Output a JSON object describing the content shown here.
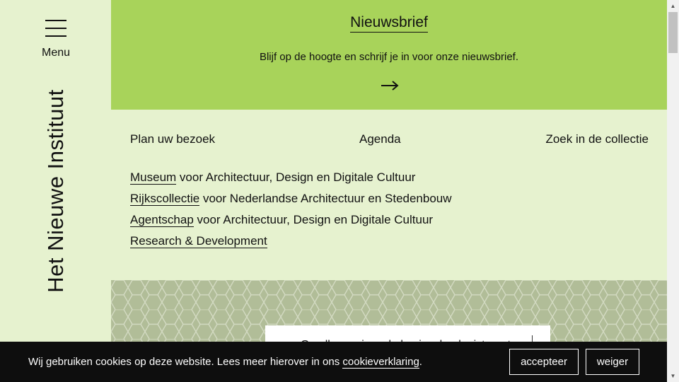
{
  "sidebar": {
    "menu_label": "Menu",
    "logo_text": "Het Nieuwe Instituut"
  },
  "newsletter": {
    "title": "Nieuwsbrief",
    "text": "Blijf op de hoogte en schrijf je in voor onze nieuwsbrief.",
    "arrow_icon": "arrow-right-icon"
  },
  "quick_links": [
    {
      "label": "Plan uw bezoek"
    },
    {
      "label": "Agenda"
    },
    {
      "label": "Zoek in de collectie"
    }
  ],
  "sections": [
    {
      "link": "Museum",
      "rest": " voor Architectuur, Design en Digitale Cultuur"
    },
    {
      "link": "Rijkscollectie",
      "rest": " voor Nederlandse Architectuur en Stedenbouw"
    },
    {
      "link": "Agentschap",
      "rest": " voor Architectuur, Design en Digitale Cultuur"
    },
    {
      "link": "Research & Development",
      "rest": ""
    }
  ],
  "hero": {
    "card_text": "Ga alle vernieuwde koningsbeek gisterent"
  },
  "cookie": {
    "text_before": "Wij gebruiken cookies op deze website. Lees meer hierover in ons ",
    "link": "cookieverklaring",
    "text_after": ".",
    "accept_label": "accepteer",
    "decline_label": "weiger"
  },
  "colors": {
    "accent_green": "#a8d35a",
    "background": "#e6f2cf",
    "hero_bg": "#b1bd98",
    "cookie_bg": "#0e0e0e"
  }
}
